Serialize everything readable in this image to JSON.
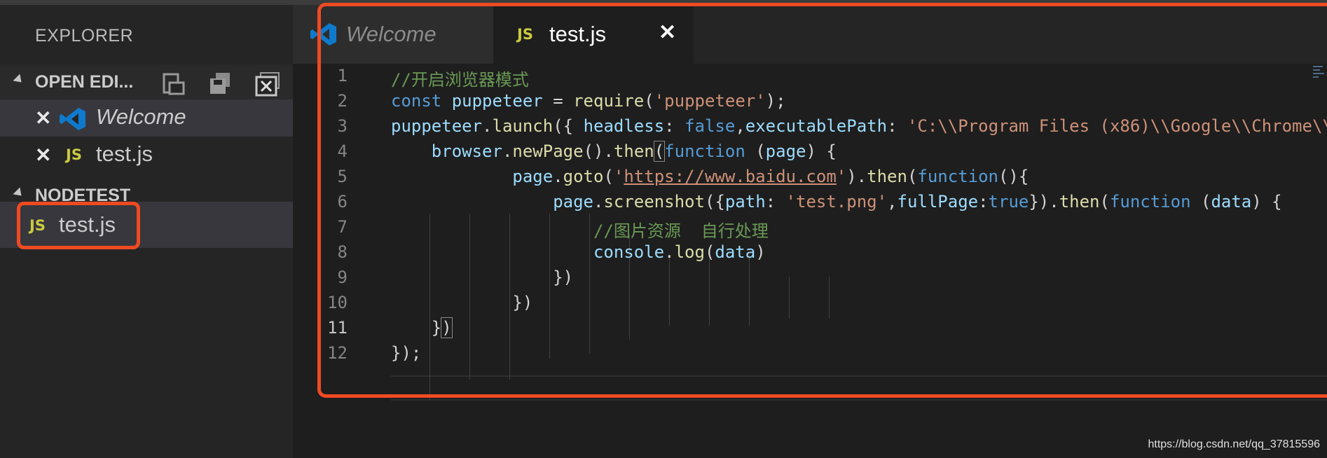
{
  "sidebar": {
    "title": "EXPLORER",
    "open_editors": {
      "label": "OPEN EDI...",
      "tools": [
        "new-file-icon",
        "save-all-icon",
        "close-all-icon"
      ],
      "items": [
        {
          "name": "Welcome",
          "icon": "vscode-icon",
          "close": "✕"
        },
        {
          "name": "test.js",
          "icon": "JS",
          "close": "✕"
        }
      ]
    },
    "folder": {
      "label": "NODETEST",
      "items": [
        {
          "name": "test.js",
          "icon": "JS"
        }
      ]
    }
  },
  "tabs": [
    {
      "label": "Welcome",
      "icon": "vscode-icon"
    },
    {
      "label": "test.js",
      "icon": "JS",
      "close": "✕"
    }
  ],
  "editor": {
    "lines": [
      {
        "num": "1"
      },
      {
        "num": "2"
      },
      {
        "num": "3"
      },
      {
        "num": "4"
      },
      {
        "num": "5"
      },
      {
        "num": "6"
      },
      {
        "num": "7"
      },
      {
        "num": "8"
      },
      {
        "num": "9"
      },
      {
        "num": "10"
      },
      {
        "num": "11"
      },
      {
        "num": "12"
      }
    ],
    "current_line": "11"
  },
  "watermark": "https://blog.csdn.net/qq_37815596",
  "colors": {
    "highlight_box": "#f04a22",
    "accent_js": "#cbcb41"
  }
}
